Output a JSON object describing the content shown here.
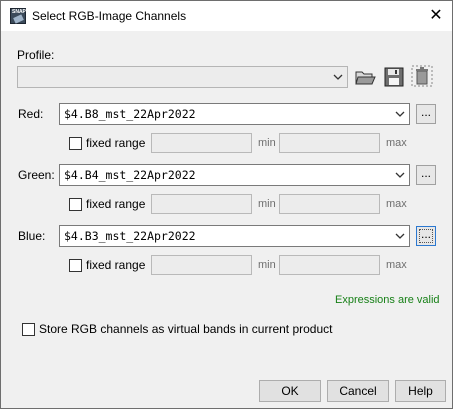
{
  "window": {
    "title": "Select RGB-Image Channels",
    "close_label": "✕"
  },
  "profile": {
    "label": "Profile:",
    "value": ""
  },
  "red": {
    "label": "Red:",
    "expression": "$4.B8_mst_22Apr2022",
    "fixed_range_label": "fixed range",
    "min_label": "min",
    "max_label": "max",
    "dots": "..."
  },
  "green": {
    "label": "Green:",
    "expression": "$4.B4_mst_22Apr2022",
    "fixed_range_label": "fixed range",
    "min_label": "min",
    "max_label": "max",
    "dots": "..."
  },
  "blue": {
    "label": "Blue:",
    "expression": "$4.B3_mst_22Apr2022",
    "fixed_range_label": "fixed range",
    "min_label": "min",
    "max_label": "max",
    "dots": "..."
  },
  "status": {
    "text": "Expressions are valid",
    "color": "#178017"
  },
  "virtual_bands": {
    "label": "Store RGB channels as virtual bands in current product"
  },
  "buttons": {
    "ok": "OK",
    "cancel": "Cancel",
    "help": "Help"
  },
  "icons": [
    "open-folder-icon",
    "save-icon",
    "delete-icon",
    "chevron-down-icon"
  ]
}
